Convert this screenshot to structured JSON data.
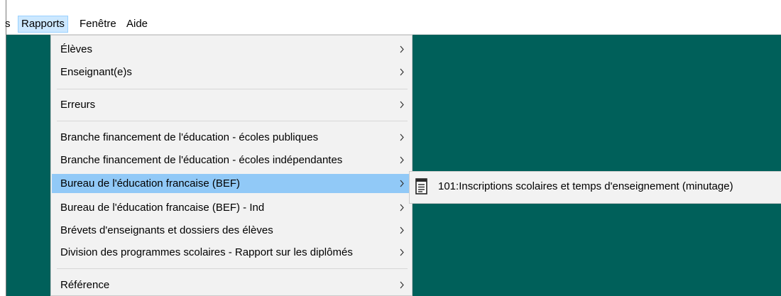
{
  "menubar": {
    "items": [
      {
        "label": "s"
      },
      {
        "label": "Rapports"
      },
      {
        "label": "Fenêtre"
      },
      {
        "label": "Aide"
      }
    ]
  },
  "rapports_menu": {
    "items": [
      {
        "label": "Élèves"
      },
      {
        "label": "Enseignant(e)s"
      },
      {
        "label": "Erreurs"
      },
      {
        "label": "Branche financement de l'éducation - écoles publiques"
      },
      {
        "label": "Branche financement de l'éducation - écoles indépendantes"
      },
      {
        "label": "Bureau de l'éducation francaise (BEF)"
      },
      {
        "label": "Bureau de l'éducation francaise (BEF) - Ind"
      },
      {
        "label": "Brévets d'enseignants et dossiers des élèves"
      },
      {
        "label": "Division des programmes scolaires - Rapport sur les diplômés"
      },
      {
        "label": "Référence"
      }
    ],
    "highlighted_item": "Bureau de l'éducation francaise (BEF)"
  },
  "bef_submenu": {
    "items": [
      {
        "label": "101:Inscriptions scolaires et temps d'enseignement (minutage)",
        "icon": "report-document-icon"
      }
    ]
  },
  "colors": {
    "workspace_background": "#00605a",
    "menu_background": "#f2f2f2",
    "highlight": "#91c9f7",
    "menubar_active": "#cce8ff"
  }
}
